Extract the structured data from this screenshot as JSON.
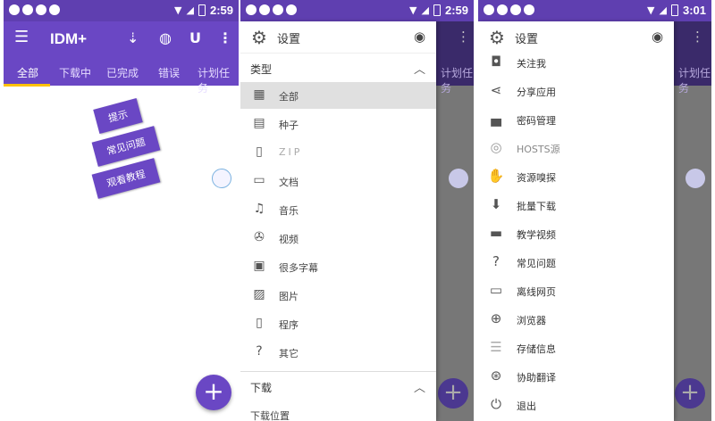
{
  "colors": {
    "primary": "#6a47c4",
    "statusbar": "#5f3fb0",
    "accent_indicator": "#ffc107"
  },
  "screen1": {
    "status": {
      "time": "2:59"
    },
    "app_title": "IDM+",
    "icons": [
      "menu-icon",
      "sort-icon",
      "globe-icon",
      "magnet-icon",
      "more-icon"
    ],
    "tabs": [
      "全部",
      "下载中",
      "已完成",
      "错误",
      "计划任务"
    ],
    "active_tab": "全部",
    "tips": [
      "提示",
      "常见问题",
      "观看教程"
    ],
    "fab_label": "+"
  },
  "screen2": {
    "status": {
      "time": "2:59"
    },
    "drawer_title": "设置",
    "section_type": {
      "label": "类型",
      "items": [
        {
          "label": "全部",
          "icon": "grid-icon"
        },
        {
          "label": "种子",
          "icon": "torrent-file-icon"
        },
        {
          "label": "ZIP",
          "icon": "zip-file-icon"
        },
        {
          "label": "文档",
          "icon": "doc-file-icon"
        },
        {
          "label": "音乐",
          "icon": "music-note-icon"
        },
        {
          "label": "视频",
          "icon": "film-reel-icon"
        },
        {
          "label": "很多字幕",
          "icon": "subtitle-file-icon"
        },
        {
          "label": "图片",
          "icon": "picture-icon"
        },
        {
          "label": "程序",
          "icon": "phone-icon"
        },
        {
          "label": "其它",
          "icon": "unknown-file-icon"
        }
      ]
    },
    "section_download": {
      "label": "下载",
      "item": "下载位置"
    },
    "bg_tab_text": "计划任务",
    "fab_label": "+"
  },
  "screen3": {
    "status": {
      "time": "3:01"
    },
    "drawer_title": "设置",
    "items": [
      {
        "label": "关注我",
        "icon": "instagram-icon"
      },
      {
        "label": "分享应用",
        "icon": "share-icon"
      },
      {
        "label": "密码管理",
        "icon": "lock-icon"
      },
      {
        "label": "HOSTS源",
        "icon": "www-icon"
      },
      {
        "label": "资源嗅探",
        "icon": "sniff-hand-icon"
      },
      {
        "label": "批量下载",
        "icon": "download-circle-icon"
      },
      {
        "label": "教学视频",
        "icon": "video-tutorial-icon"
      },
      {
        "label": "常见问题",
        "icon": "question-person-icon"
      },
      {
        "label": "离线网页",
        "icon": "offline-page-icon"
      },
      {
        "label": "浏览器",
        "icon": "browser-globe-icon"
      },
      {
        "label": "存储信息",
        "icon": "storage-info-icon"
      },
      {
        "label": "协助翻译",
        "icon": "translate-globe-icon"
      },
      {
        "label": "退出",
        "icon": "power-icon"
      }
    ],
    "bg_tab_text": "计划任务",
    "fab_label": "+"
  }
}
